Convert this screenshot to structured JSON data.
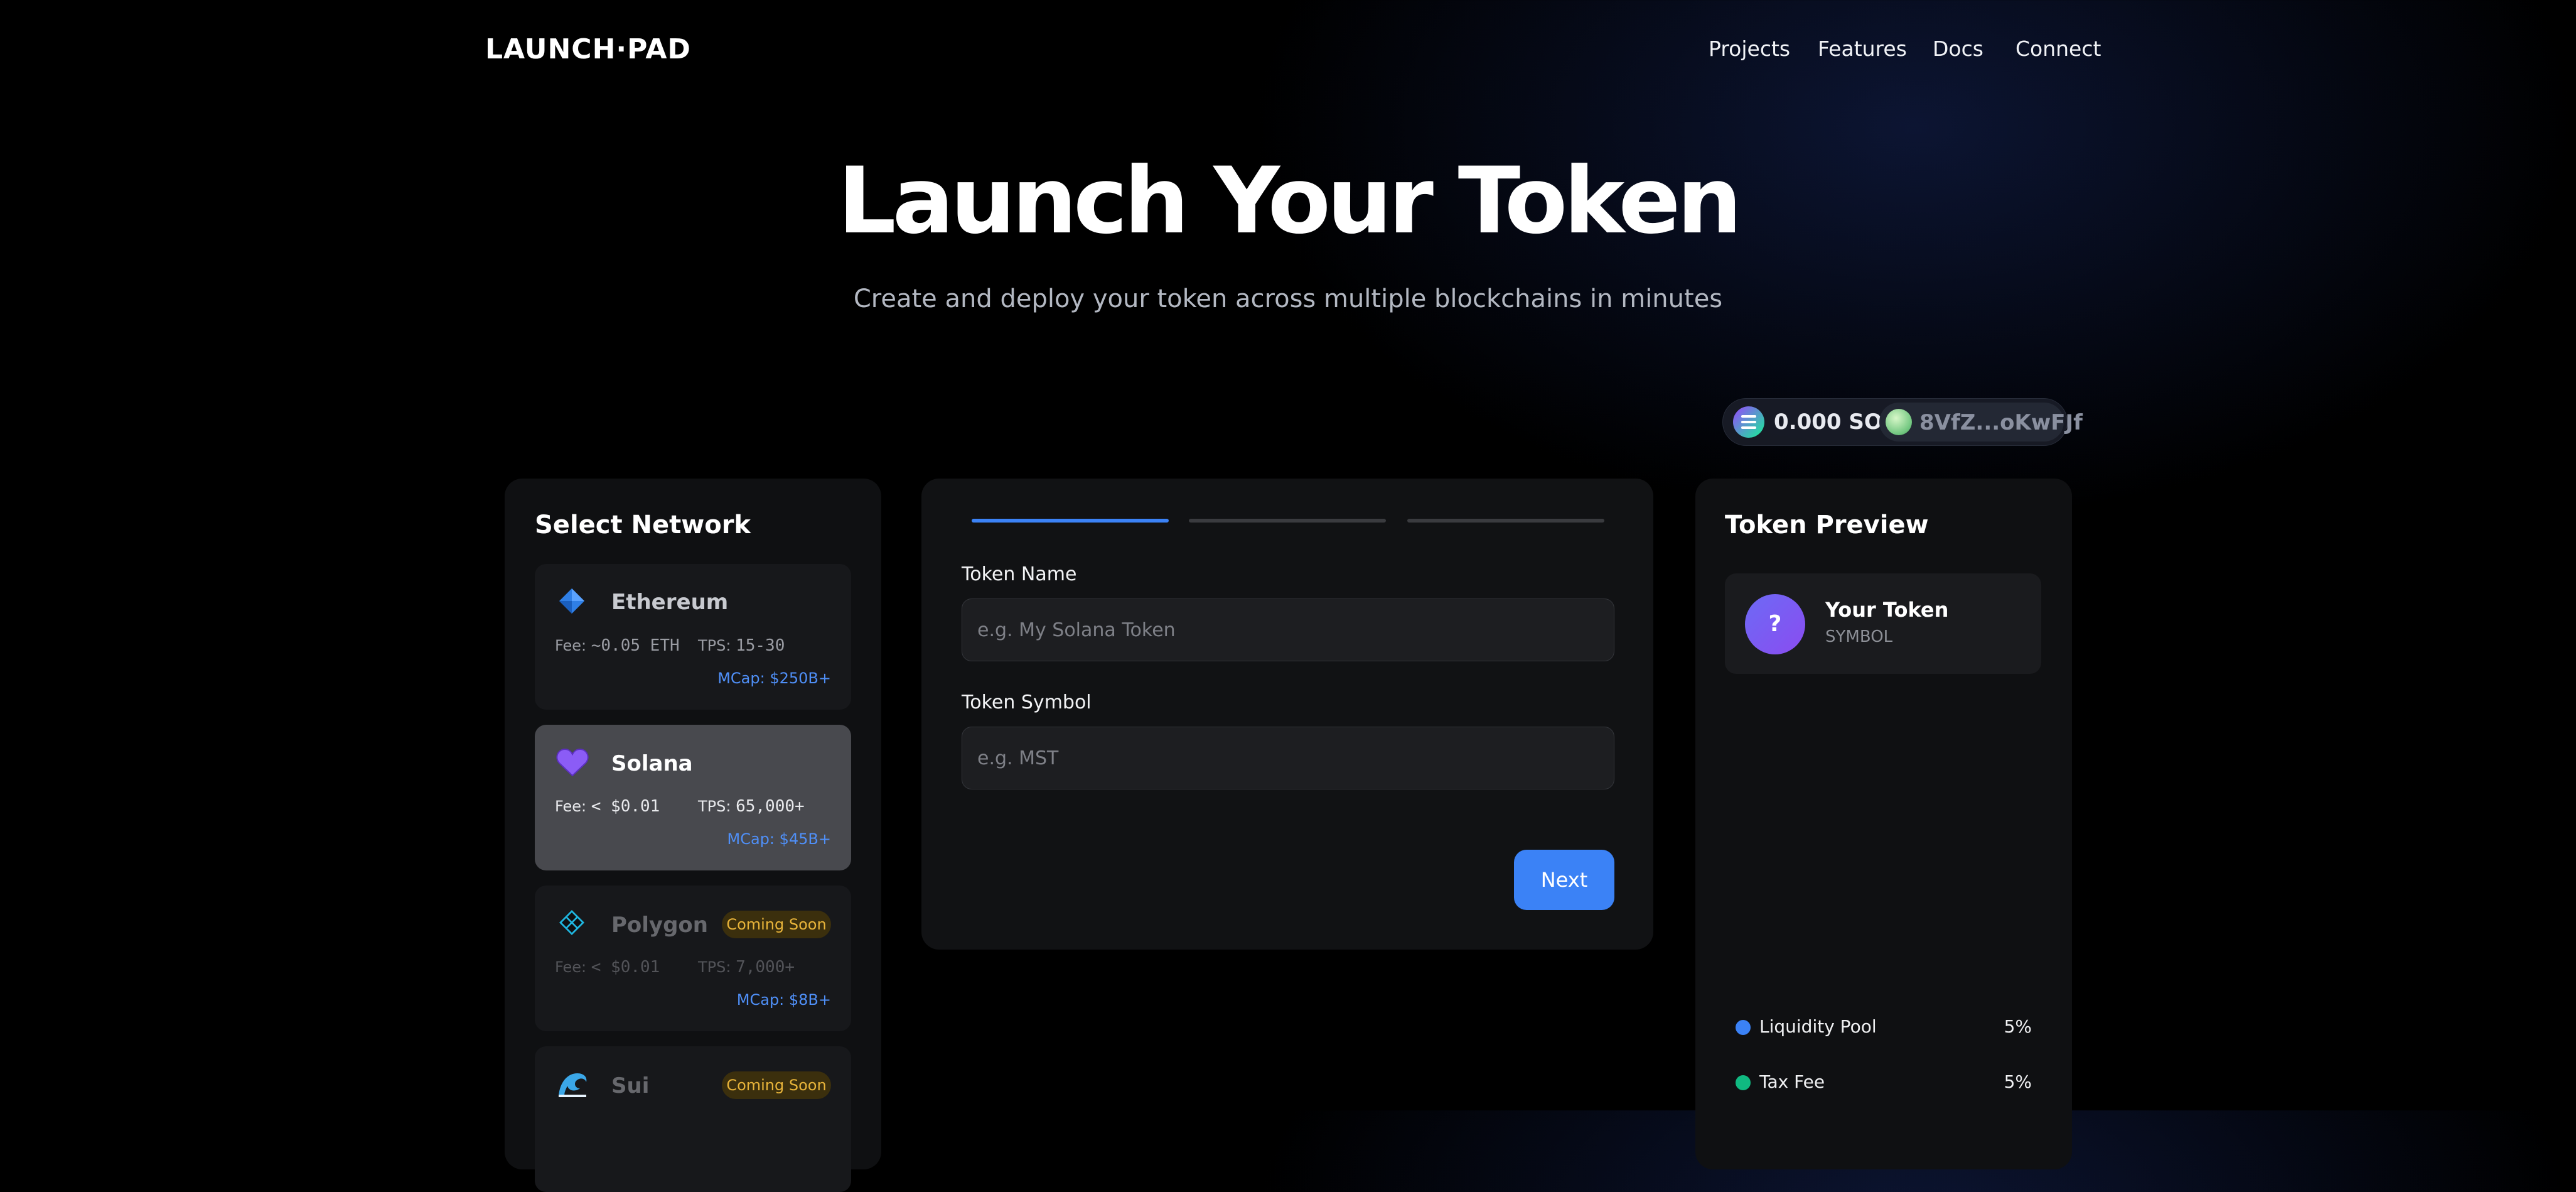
{
  "header": {
    "logo": "LAUNCH·PAD",
    "nav": [
      "Projects",
      "Features",
      "Docs",
      "Connect"
    ]
  },
  "hero": {
    "title": "Launch Your Token",
    "subtitle": "Create and deploy your token across multiple blockchains in minutes"
  },
  "wallet": {
    "balance": "0.000 SOL",
    "address": "8VfZ...oKwFJf"
  },
  "network_panel": {
    "title": "Select Network",
    "fee_label": "Fee:",
    "tps_label": "TPS:",
    "networks": [
      {
        "name": "Ethereum",
        "icon": "ethereum-diamond-icon",
        "fee": "~0.05 ETH",
        "tps": "15-30",
        "mcap": "MCap: $250B+",
        "selected": false,
        "badge": ""
      },
      {
        "name": "Solana",
        "icon": "purple-heart-icon",
        "fee": "< $0.01",
        "tps": "65,000+",
        "mcap": "MCap: $45B+",
        "selected": true,
        "badge": ""
      },
      {
        "name": "Polygon",
        "icon": "polygon-icon",
        "fee": "< $0.01",
        "tps": "7,000+",
        "mcap": "MCap: $8B+",
        "selected": false,
        "badge": "Coming Soon"
      },
      {
        "name": "Sui",
        "icon": "wave-icon",
        "fee": "",
        "tps": "",
        "mcap": "",
        "selected": false,
        "badge": "Coming Soon"
      }
    ]
  },
  "form": {
    "steps_total": 3,
    "current_step": 1,
    "token_name_label": "Token Name",
    "token_name_placeholder": "e.g. My Solana Token",
    "token_name_value": "",
    "token_symbol_label": "Token Symbol",
    "token_symbol_placeholder": "e.g. MST",
    "token_symbol_value": "",
    "next_label": "Next"
  },
  "preview": {
    "title": "Token Preview",
    "avatar_glyph": "?",
    "token_name": "Your Token",
    "token_symbol": "SYMBOL",
    "distribution": [
      {
        "label": "Liquidity Pool",
        "value": "5%",
        "color": "#3b82f6"
      },
      {
        "label": "Tax Fee",
        "value": "5%",
        "color": "#10b981"
      }
    ]
  },
  "colors": {
    "accent": "#3b82f6",
    "badge_text": "#e8b43a",
    "mcap_text": "#4f8ff7"
  }
}
